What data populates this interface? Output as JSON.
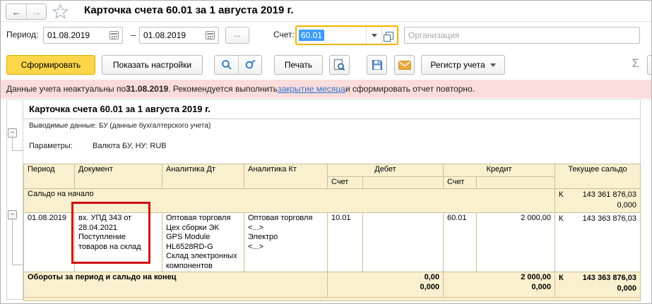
{
  "colors": {
    "accent_yellow": "#ffd64a",
    "focus_yellow": "#f0b400",
    "selection_blue": "#3d9bff",
    "alert_bg": "#fbdcdc",
    "link_blue": "#3076c9",
    "annotation_red": "#cf0d0d",
    "table_cream": "#f9f0cf"
  },
  "window": {
    "title": "Карточка счета 60.01 за 1 августа 2019 г.",
    "back": "←",
    "forward": "→"
  },
  "filter": {
    "period_label": "Период:",
    "date_from": "01.08.2019",
    "date_to": "01.08.2019",
    "dash": "–",
    "more_button": "...",
    "account_label": "Счет:",
    "account_value": "60.01",
    "org_placeholder": "Организация"
  },
  "toolbar": {
    "generate": "Сформировать",
    "settings": "Показать настройки",
    "print": "Печать",
    "register": "Регистр учета",
    "sigma": "Σ"
  },
  "alert": {
    "text_before": "Данные учета неактуальны по ",
    "date": "31.08.2019",
    "text_middle": ". Рекомендуется выполнить ",
    "link": "закрытие месяца",
    "text_after": " и сформировать отчет повторно."
  },
  "report": {
    "title": "Карточка счета 60.01 за 1 августа 2019 г.",
    "output_data": "Выводимые данные: БУ (данные бухгалтерского учета)",
    "params_label": "Параметры:",
    "params_value": "Валюта БУ, НУ: RUB"
  },
  "table": {
    "headers": {
      "period": "Период",
      "document": "Документ",
      "analytics_dt": "Аналитика Дт",
      "analytics_kt": "Аналитика Кт",
      "debit": "Дебет",
      "credit": "Кредит",
      "balance": "Текущее сальдо",
      "account_dt": "Счет",
      "account_kt": "Счет"
    },
    "opening": {
      "label": "Сальдо на начало",
      "balance_ind": "К",
      "balance_1": "143 361 876,03",
      "balance_2": "0,000"
    },
    "row": {
      "period": "01.08.2019",
      "document": "вх. УПД 343 от\n28.04.2021\nПоступление\nтоваров на склад",
      "analytics_dt": "Оптовая торговля\nЦех сборки ЭК\nGPS Module\nHL6528RD-G\nСклад электронных\nкомпонентов",
      "analytics_kt": "Оптовая торговля\n<...>\nЭлектро\n<...>",
      "debit_account": "10.01",
      "debit_sum": "",
      "credit_account": "60.01",
      "credit_sum": "2 000,00",
      "balance_ind": "К",
      "balance": "143 363 876,03"
    },
    "totals": {
      "label": "Обороты за период и сальдо на конец",
      "debit_1": "0,00",
      "debit_2": "0,000",
      "credit_1": "2 000,00",
      "credit_2": "0,000",
      "balance_ind": "К",
      "balance_1": "143 363 876,03",
      "balance_2": "0,000"
    }
  }
}
